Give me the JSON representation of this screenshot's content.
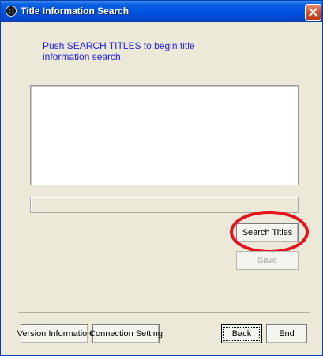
{
  "window": {
    "title": "Title Information Search",
    "colors": {
      "titlebar": "#0054e3",
      "message_text": "#1f1fe8",
      "highlight_ring": "#e8101a",
      "face": "#ece9d8"
    }
  },
  "message": {
    "line1": "Push SEARCH TITLES to begin title",
    "line2": "information search."
  },
  "buttons": {
    "search_titles": "Search Titles",
    "save": "Save",
    "version_information": "Version Information",
    "connection_setting": "Connection Setting",
    "back": "Back",
    "end": "End"
  },
  "icons": {
    "app": "app-icon",
    "close": "close-icon"
  }
}
